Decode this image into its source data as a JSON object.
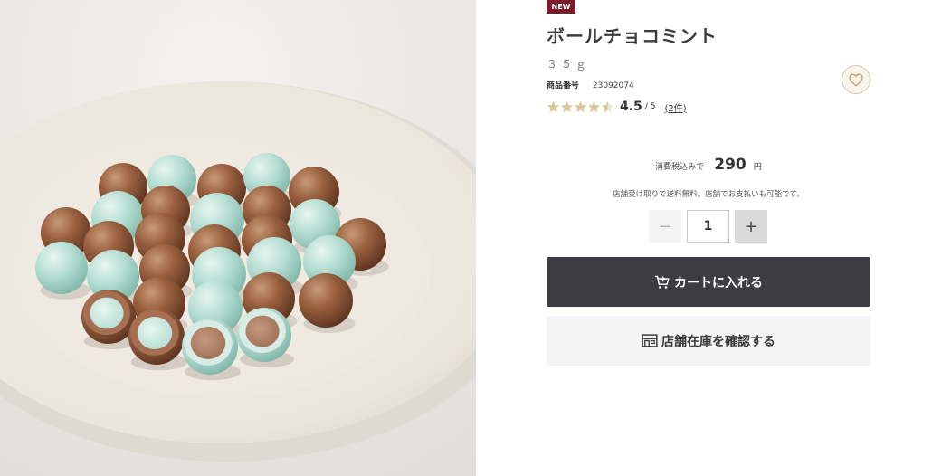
{
  "product": {
    "badge": "NEW",
    "title": "ボールチョコミント",
    "weight": "３５ｇ",
    "code_label": "商品番号",
    "code_value": "23092074",
    "rating": {
      "value": "4.5",
      "max": "/ 5",
      "count": "(2件)",
      "stars_filled": 4.5,
      "stars_total": 5
    }
  },
  "price": {
    "label": "消費税込みで",
    "value": "290",
    "unit": "円",
    "notice": "店舗受け取りで送料無料。店舗でお支払いも可能です。"
  },
  "quantity": {
    "minus_label": "−",
    "value": "1",
    "plus_label": "+"
  },
  "actions": {
    "cart_label": "カートに入れる",
    "store_label": "店舗在庫を確認する"
  },
  "icons": {
    "favorite": "heart-icon",
    "cart": "cart-icon",
    "store": "store-icon"
  },
  "colors": {
    "badge_bg": "#7a1a2a",
    "badge_text": "#ffffff",
    "star_filled": "#d8c898",
    "star_empty": "#e6e0d0",
    "cart_bg": "#3c3c41",
    "store_bg": "#f4f4f4",
    "favorite_border": "#d8cbb1"
  }
}
